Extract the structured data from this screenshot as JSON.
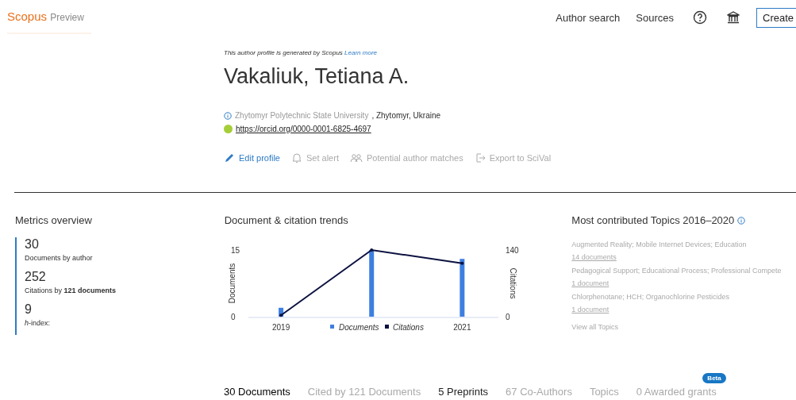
{
  "header": {
    "logo": "Scopus",
    "logo_suffix": "Preview",
    "nav": [
      "Author search",
      "Sources"
    ],
    "create_button": "Create"
  },
  "profile": {
    "notice": "This author profile is generated by Scopus",
    "notice_link": "Learn more",
    "name": "Vakaliuk, Tetiana A.",
    "affiliation": "Zhytomyr Polytechnic State University",
    "location": ", Zhytomyr, Ukraine",
    "orcid": "https://orcid.org/0000-0001-6825-4697",
    "actions": [
      {
        "label": "Edit profile",
        "kind": "edit",
        "disabled": false
      },
      {
        "label": "Set alert",
        "kind": "alert",
        "disabled": true
      },
      {
        "label": "Potential author matches",
        "kind": "people",
        "disabled": true
      },
      {
        "label": "Export to SciVal",
        "kind": "export",
        "disabled": true
      }
    ]
  },
  "metrics": {
    "title": "Metrics overview",
    "items": [
      {
        "value": "30",
        "label": "Documents by author"
      },
      {
        "value": "252",
        "label": "Citations by **121 documents**"
      },
      {
        "value": "9",
        "label": "*h*-index:"
      }
    ]
  },
  "trends": {
    "title": "Document & citation trends",
    "chart_data": {
      "type": "bar",
      "legend": "bottom",
      "x": [
        2019,
        2020,
        2021
      ],
      "xlim": [
        2018.64,
        2021.4
      ],
      "xticks": [
        2019,
        2021
      ],
      "ylabel": "Documents",
      "yticks": [
        0,
        15
      ],
      "ylim": [
        0,
        15
      ],
      "y2label": "Citations",
      "y2ticks": [
        0,
        140
      ],
      "y2lim": [
        0,
        140
      ],
      "series": [
        {
          "name": "Documents",
          "color": "#3d7fe0",
          "values": [
            2,
            15,
            13
          ]
        },
        {
          "name": "Citations",
          "color": "#0c1240",
          "type": "line",
          "axis": "y2",
          "values": [
            3,
            140,
            112
          ]
        }
      ]
    }
  },
  "topics": {
    "title": "Most contributed Topics 2016–2020",
    "items": [
      {
        "name": "Augmented Reality; Mobile Internet Devices; Education",
        "count": "14 documents"
      },
      {
        "name": "Pedagogical Support; Educational Process; Professional Compete",
        "count": "1 document"
      },
      {
        "name": "Chlorphenotane; HCH; Organochlorine Pesticides",
        "count": "1 document"
      }
    ],
    "view_all": "View all Topics"
  },
  "tabs": [
    {
      "label": "30 Documents",
      "selected": true,
      "disabled": false
    },
    {
      "label": "Cited by 121 Documents",
      "selected": false,
      "disabled": true
    },
    {
      "label": "5 Preprints",
      "selected": false,
      "disabled": false
    },
    {
      "label": "67 Co-Authors",
      "selected": false,
      "disabled": true
    },
    {
      "label": "Topics",
      "selected": false,
      "disabled": true
    },
    {
      "label": "0 Awarded grants",
      "selected": false,
      "disabled": true,
      "badge": "Beta"
    }
  ]
}
